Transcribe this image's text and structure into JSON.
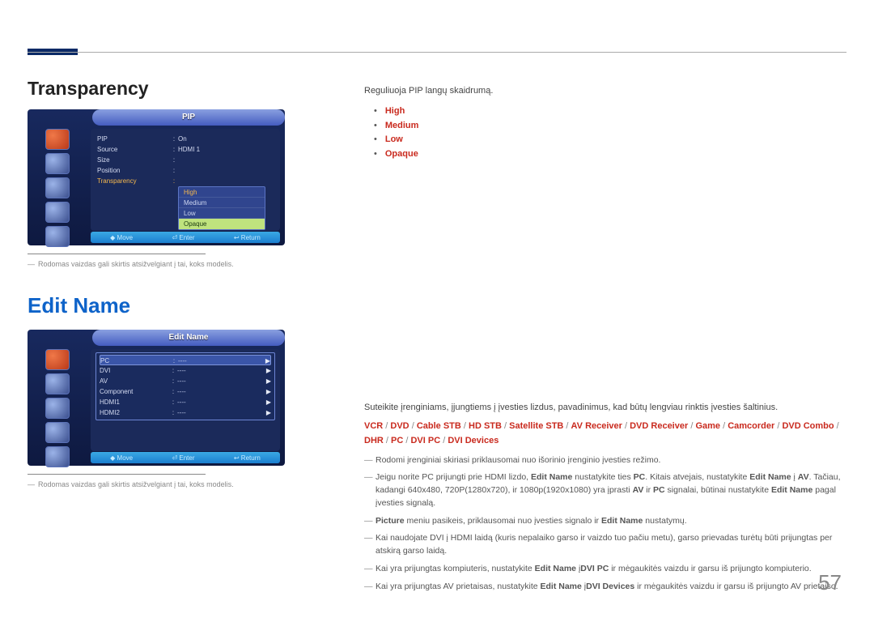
{
  "page_number": "57",
  "headings": {
    "transparency": "Transparency",
    "edit_name": "Edit Name"
  },
  "disclaimer": "Rodomas vaizdas gali skirtis atsižvelgiant į tai, koks modelis.",
  "osd_pip": {
    "title": "PIP",
    "rows": {
      "pip_lbl": "PIP",
      "pip_val": "On",
      "source_lbl": "Source",
      "source_val": "HDMI 1",
      "size_lbl": "Size",
      "size_val": "",
      "position_lbl": "Position",
      "position_val": "",
      "transparency_lbl": "Transparency"
    },
    "options": {
      "o1": "High",
      "o2": "Medium",
      "o3": "Low",
      "o4": "Opaque"
    },
    "footer": {
      "move": "Move",
      "enter": "Enter",
      "return": "Return"
    }
  },
  "osd_edit": {
    "title": "Edit Name",
    "rows": {
      "pc": "PC",
      "dvi": "DVI",
      "av": "AV",
      "component": "Component",
      "hdmi1": "HDMI1",
      "hdmi2": "HDMI2",
      "dash": "----"
    },
    "footer": {
      "move": "Move",
      "enter": "Enter",
      "return": "Return"
    }
  },
  "right": {
    "transparency_intro": "Reguliuoja PIP langų skaidrumą.",
    "bullets": {
      "high": "High",
      "medium": "Medium",
      "low": "Low",
      "opaque": "Opaque"
    },
    "edit_intro": "Suteikite įrenginiams, įjungtiems į įvesties lizdus, pavadinimus, kad būtų lengviau rinktis įvesties šaltinius.",
    "devices": {
      "vcr": "VCR",
      "dvd": "DVD",
      "cable": "Cable STB",
      "hd": "HD STB",
      "sat": "Satellite STB",
      "avr": "AV Receiver",
      "dvdr": "DVD Receiver",
      "game": "Game",
      "cam": "Camcorder",
      "combo": "DVD Combo",
      "dhr": "DHR",
      "pc": "PC",
      "dvipc": "DVI PC",
      "dvidev": "DVI Devices"
    },
    "note1": "Rodomi įrenginiai skiriasi priklausomai nuo išorinio įrenginio įvesties režimo.",
    "note2_a": "Jeigu norite PC prijungti prie HDMI lizdo, ",
    "note2_b": " nustatykite ties ",
    "note2_c": ". Kitais atvejais, nustatykite ",
    "note2_d": " į ",
    "note2_e": ". Tačiau, kadangi 640x480, 720P(1280x720), ir 1080p(1920x1080) yra įprasti ",
    "note2_f": " ir ",
    "note2_g": " signalai, būtinai nustatykite ",
    "note2_h": " pagal įvesties signalą.",
    "bold_editname": "Edit Name",
    "bold_pc": "PC",
    "bold_av": "AV",
    "pic_label": "Picture",
    "note3_a": " meniu pasikeis, priklausomai nuo įvesties signalo ir ",
    "note3_b": " nustatymų.",
    "note4": "Kai naudojate DVI į HDMI laidą (kuris nepalaiko garso ir vaizdo tuo pačiu metu), garso prievadas turėtų būti prijungtas per atskirą garso laidą.",
    "note5_a": "Kai yra prijungtas kompiuteris, nustatykite ",
    "note5_b": " į",
    "note5_dvipc": "DVI PC",
    "note5_c": " ir mėgaukitės vaizdu ir garsu iš prijungto kompiuterio.",
    "note6_a": "Kai yra prijungtas AV prietaisas, nustatykite ",
    "note6_b": " į",
    "note6_dvidev": "DVI Devices",
    "note6_c": " ir mėgaukitės vaizdu ir garsu iš prijungto AV prietaiso."
  }
}
